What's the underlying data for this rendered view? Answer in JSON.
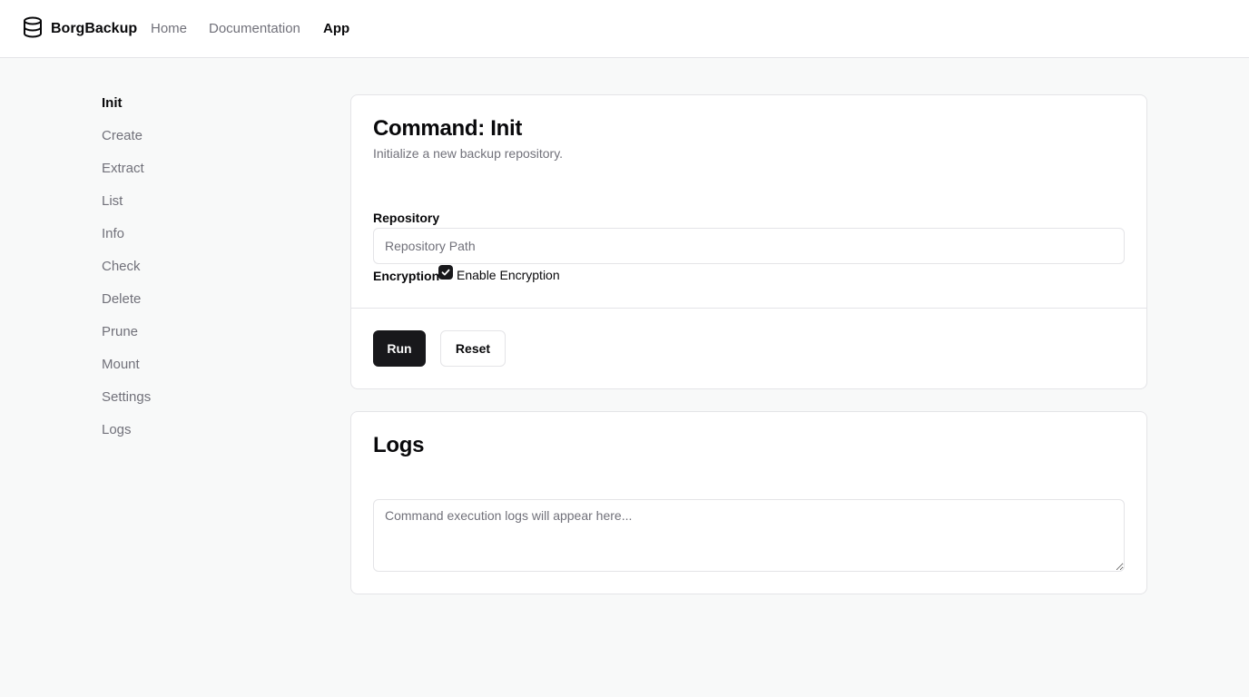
{
  "header": {
    "brand": "BorgBackup",
    "brand_icon": "database-icon",
    "nav": [
      {
        "label": "Home",
        "active": false
      },
      {
        "label": "Documentation",
        "active": false
      },
      {
        "label": "App",
        "active": true
      }
    ]
  },
  "sidebar": {
    "items": [
      {
        "label": "Init",
        "active": true
      },
      {
        "label": "Create",
        "active": false
      },
      {
        "label": "Extract",
        "active": false
      },
      {
        "label": "List",
        "active": false
      },
      {
        "label": "Info",
        "active": false
      },
      {
        "label": "Check",
        "active": false
      },
      {
        "label": "Delete",
        "active": false
      },
      {
        "label": "Prune",
        "active": false
      },
      {
        "label": "Mount",
        "active": false
      },
      {
        "label": "Settings",
        "active": false
      },
      {
        "label": "Logs",
        "active": false
      }
    ]
  },
  "command_card": {
    "title": "Command: Init",
    "description": "Initialize a new backup repository.",
    "repository": {
      "label": "Repository",
      "value": "",
      "placeholder": "Repository Path"
    },
    "encryption": {
      "label": "Encryption",
      "checkbox_label": "Enable Encryption",
      "checked": true
    },
    "run_label": "Run",
    "reset_label": "Reset"
  },
  "logs_card": {
    "title": "Logs",
    "value": "",
    "placeholder": "Command execution logs will appear here..."
  },
  "colors": {
    "primary": "#18181b",
    "muted_text": "#71717a",
    "border": "#e4e4e7",
    "background": "#f8f9f9"
  }
}
